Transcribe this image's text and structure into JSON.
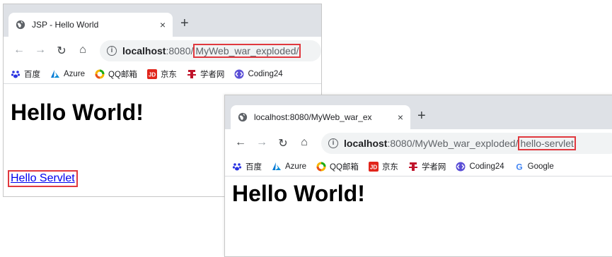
{
  "window1": {
    "tab_title": "JSP - Hello World",
    "url_host": "localhost",
    "url_port": ":8080/",
    "url_path": "MyWeb_war_exploded/",
    "heading": "Hello World!",
    "link_text": "Hello Servlet"
  },
  "window2": {
    "tab_title": "localhost:8080/MyWeb_war_ex",
    "url_host": "localhost",
    "url_port": ":8080/MyWeb_war_exploded/",
    "url_path": "hello-servlet",
    "heading": "Hello World!"
  },
  "tab_close_glyph": "×",
  "new_tab_glyph": "+",
  "bookmarks1": [
    "百度",
    "Azure",
    "QQ邮箱",
    "京东",
    "学者网",
    "Coding24"
  ],
  "bookmarks2": [
    "百度",
    "Azure",
    "QQ邮箱",
    "京东",
    "学者网",
    "Coding24",
    "Google"
  ],
  "icons": {
    "baidu": "baidu-paw-icon",
    "azure": "azure-icon",
    "qqmail": "qqmail-icon",
    "jd": "jd-icon",
    "scholar": "scholar-icon",
    "coding": "coding-icon",
    "google": "google-icon"
  },
  "colors": {
    "highlight_box": "#e0383e",
    "link": "#0000ee",
    "tabstrip": "#dee1e6"
  }
}
